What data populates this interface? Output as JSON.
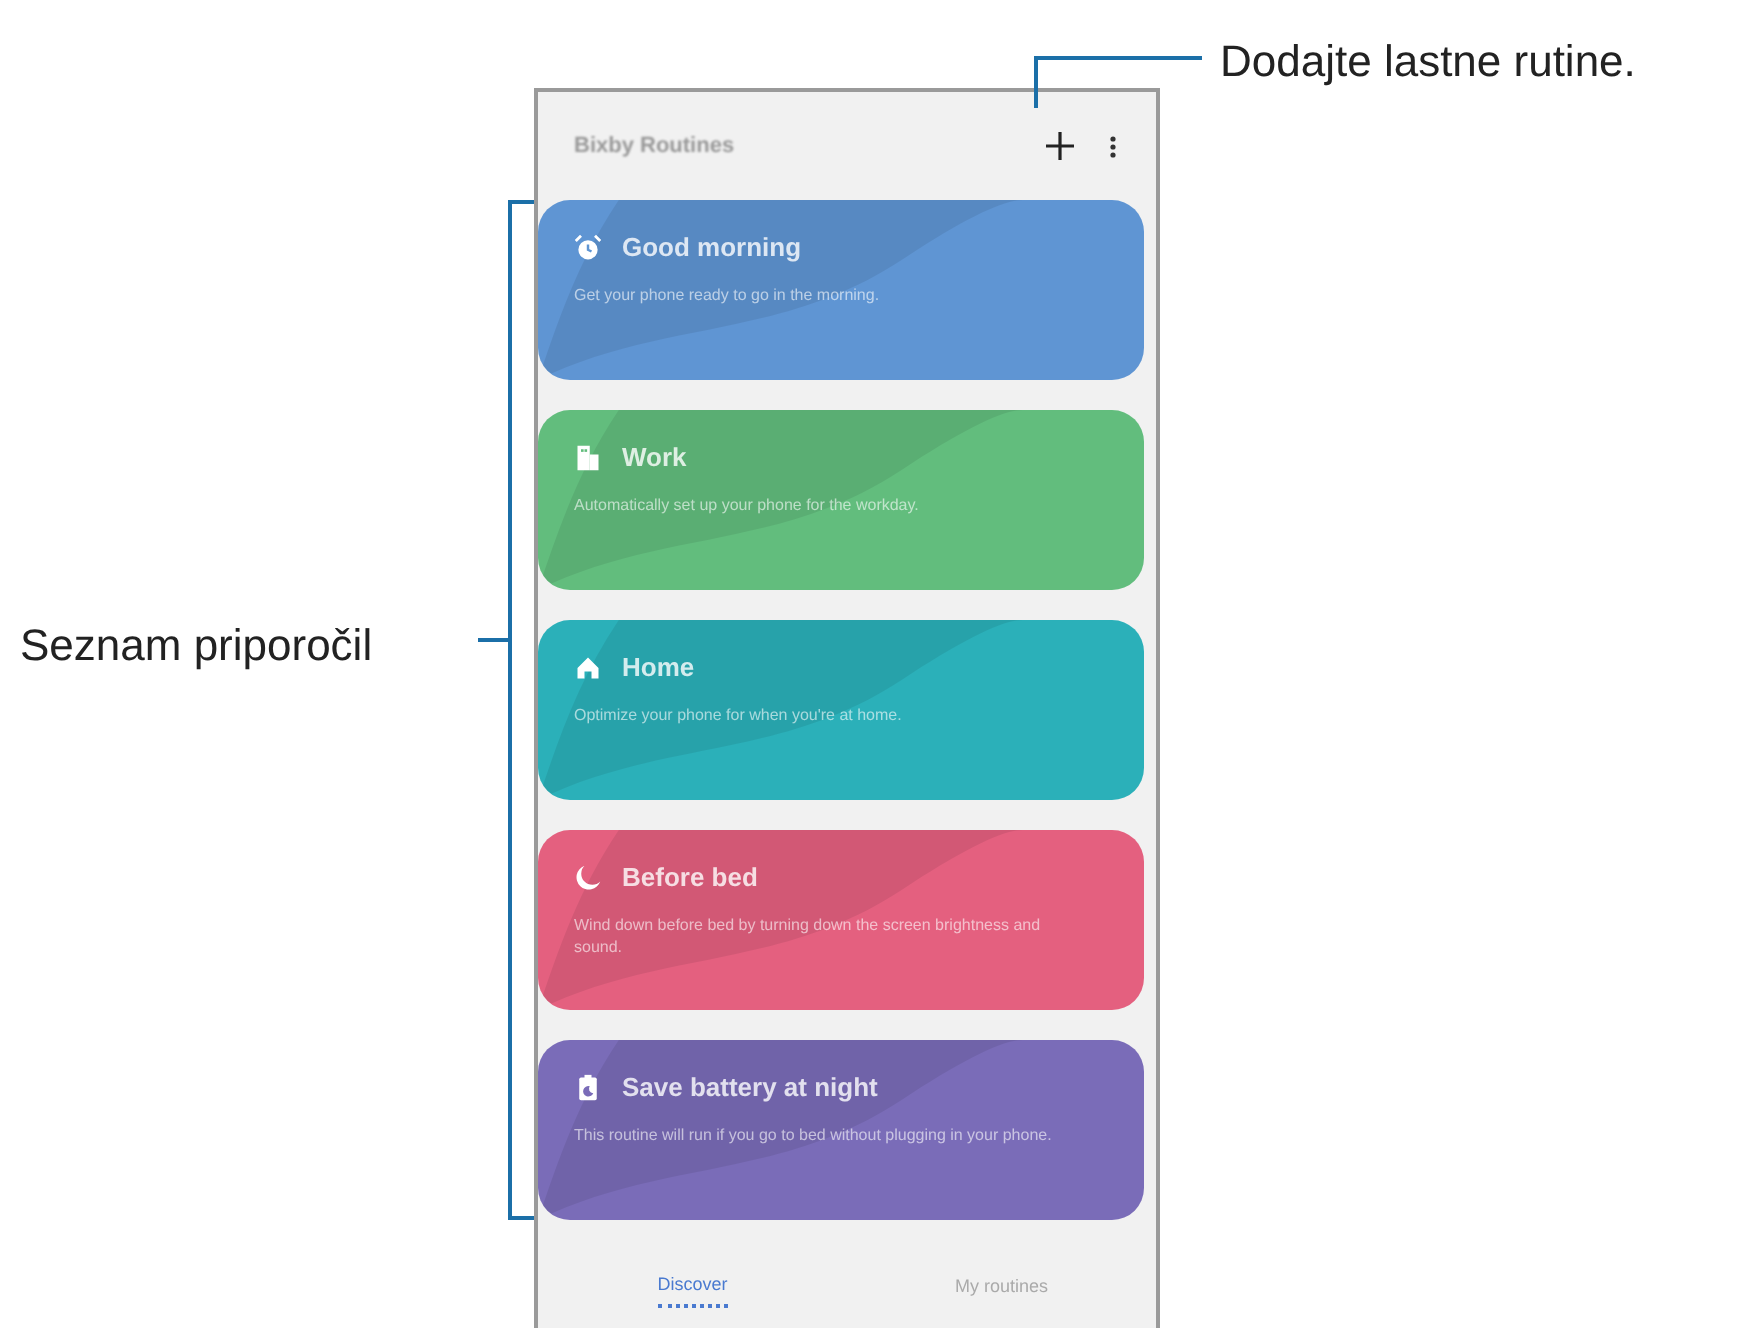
{
  "callouts": [
    {
      "text": "Dodajte lastne rutine.",
      "kind": "top"
    },
    {
      "text": "Seznam priporočil",
      "kind": "bracket"
    }
  ],
  "app_bar": {
    "title": "Bixby Routines"
  },
  "cards": [
    {
      "kind": "alarm",
      "title": "Good morning",
      "description": "Get your phone ready to go in the morning.",
      "color": "#5f95d3"
    },
    {
      "kind": "building",
      "title": "Work",
      "description": "Automatically set up your phone for the workday.",
      "color": "#62bd7d"
    },
    {
      "kind": "home",
      "title": "Home",
      "description": "Optimize your phone for when you're at home.",
      "color": "#2bb0b9"
    },
    {
      "kind": "moon",
      "title": "Before bed",
      "description": "Wind down before bed by turning down the screen brightness and sound.",
      "color": "#e4607f"
    },
    {
      "kind": "battery",
      "title": "Save battery at night",
      "description": "This routine will run if you go to bed without plugging in your phone.",
      "color": "#7a6cb8"
    }
  ],
  "tabs": [
    {
      "label": "Discover",
      "selected": true
    },
    {
      "label": "My routines",
      "selected": false
    }
  ]
}
